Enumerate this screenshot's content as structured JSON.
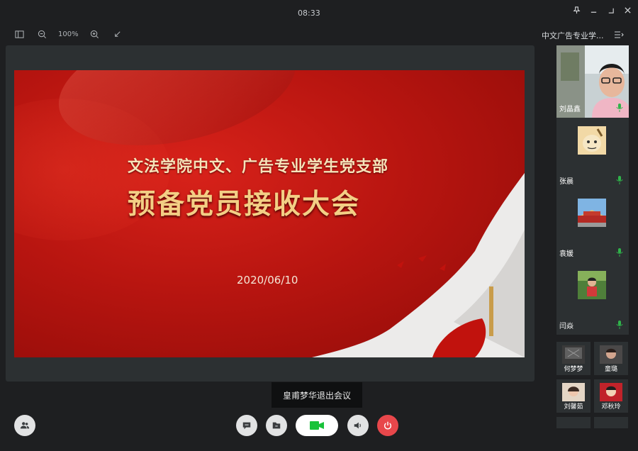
{
  "titlebar": {
    "time": "08:33"
  },
  "toolbar": {
    "zoom": "100%"
  },
  "slide": {
    "line1": "文法学院中文、广告专业学生党支部",
    "line2": "预备党员接收大会",
    "date": "2020/06/10"
  },
  "toast": "皇甫梦华退出会议",
  "panel": {
    "title": "中文广告专业学..."
  },
  "participants": [
    {
      "name": "刘晶鑫",
      "avatar": "webcam-video"
    },
    {
      "name": "张晨",
      "avatar": "cartoon-avatar"
    },
    {
      "name": "袁媛",
      "avatar": "tiananmen-avatar"
    },
    {
      "name": "闫焱",
      "avatar": "photo-avatar"
    }
  ],
  "grid": [
    {
      "name": "何梦梦"
    },
    {
      "name": "童璐"
    },
    {
      "name": "刘馨茹"
    },
    {
      "name": "邓秋玲"
    }
  ],
  "colors": {
    "hangup": "#e8474b",
    "video_on": "#19c23a",
    "mic": "#2fb34a"
  }
}
